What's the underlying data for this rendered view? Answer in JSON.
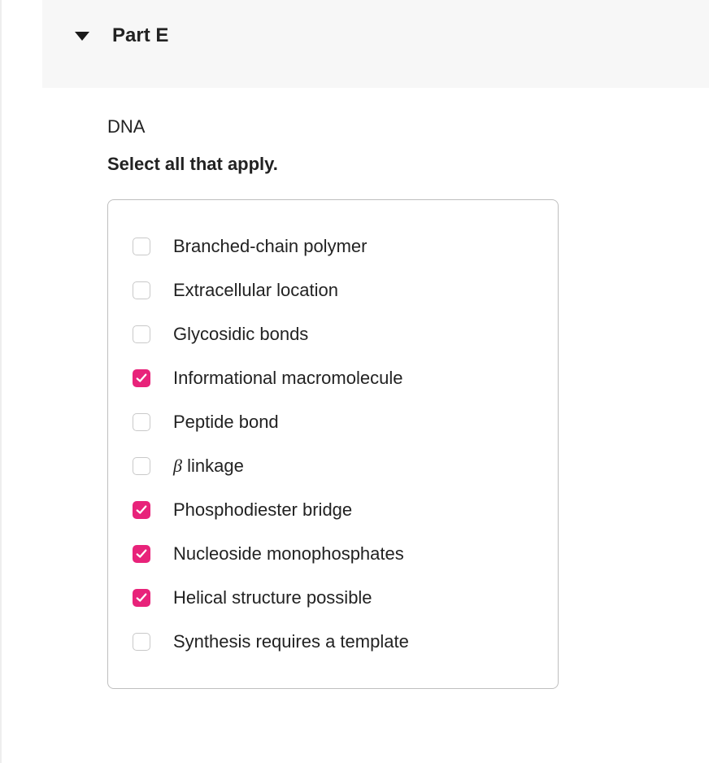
{
  "header": {
    "title": "Part E"
  },
  "content": {
    "subject": "DNA",
    "instruction": "Select all that apply."
  },
  "options": [
    {
      "label": "Branched-chain polymer",
      "checked": false
    },
    {
      "label": "Extracellular location",
      "checked": false
    },
    {
      "label": "Glycosidic bonds",
      "checked": false
    },
    {
      "label": "Informational macromolecule",
      "checked": true
    },
    {
      "label": "Peptide bond",
      "checked": false
    },
    {
      "label": "β linkage",
      "checked": false,
      "special": "beta"
    },
    {
      "label": "Phosphodiester bridge",
      "checked": true
    },
    {
      "label": "Nucleoside monophosphates",
      "checked": true
    },
    {
      "label": "Helical structure possible",
      "checked": true
    },
    {
      "label": "Synthesis requires a template",
      "checked": false
    }
  ]
}
